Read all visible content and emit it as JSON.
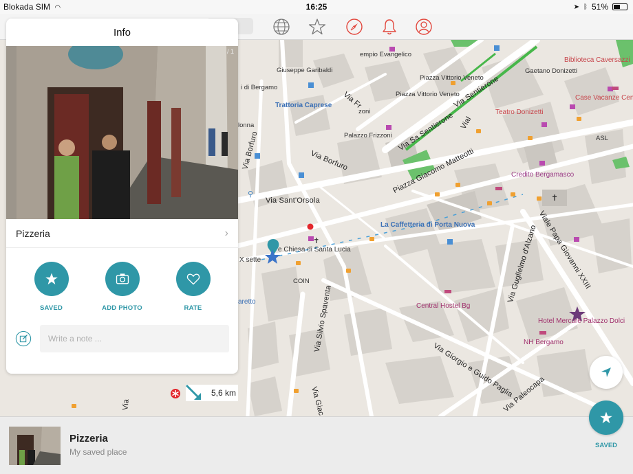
{
  "status_bar": {
    "carrier": "Blokada SIM",
    "time": "16:25",
    "battery": "51%",
    "battery_fraction": 0.51
  },
  "toolbar": {
    "icons": [
      "globe-icon",
      "star-icon",
      "compass-icon",
      "bell-icon",
      "profile-icon"
    ],
    "accent_color": "#e2463c"
  },
  "info_panel": {
    "title": "Info",
    "photo_counter": "/ 1",
    "place_name": "Pizzeria",
    "actions": [
      {
        "label": "SAVED",
        "icon": "star-icon"
      },
      {
        "label": "ADD PHOTO",
        "icon": "camera-icon"
      },
      {
        "label": "RATE",
        "icon": "heart-icon"
      }
    ],
    "note_placeholder": "Write a note ...",
    "accent_color": "#2f97a7"
  },
  "map": {
    "distance": "5,6 km",
    "streets": [
      "Via Borfuro",
      "Via Sant'Orsola",
      "Piazza Giacomo Matteotti",
      "Via Sentierone",
      "Via Sa Sentierone",
      "Viale Papa Giovanni XXIII",
      "Via Guglielmo d'Alzano",
      "Via Silvio Spaventa",
      "Via Giorgio e Guido Paglia",
      "Via Paleocapa",
      "Via Borfuro",
      "Via Fr",
      "Vial",
      "Via Giac",
      "Via"
    ],
    "labels": [
      "empio Evangelico",
      "Giuseppe Garibaldi",
      "Piazza Vittorio Veneto",
      "Gaetano Donizetti",
      "i di Bergamo",
      "Piazza Vittorio Veneto",
      "Trattoria Caprese",
      "Teatro Donizetti",
      "zoni",
      "Palazzo Frizzoni",
      "lonna",
      "ASL",
      "Credito Bergamasco",
      "La Caffetteria di Porta Nuova",
      "X sette",
      "e Chiesa di Santa Lucia",
      "COIN",
      "aretto",
      "Central Hostel Bg",
      "Hotel Mercure Palazzo Dolci",
      "NH Bergamo",
      "Biblioteca Caversazzi",
      "Case Vacanze Cen"
    ]
  },
  "bottom_bar": {
    "title": "Pizzeria",
    "subtitle": "My saved place",
    "saved_label": "SAVED"
  }
}
